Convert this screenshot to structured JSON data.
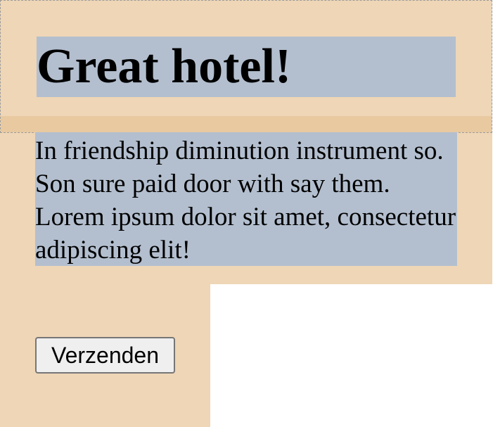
{
  "header": {
    "title": "Great hotel!"
  },
  "content": {
    "paragraph": "In friendship diminution instrument so. Son sure paid door with say them. Lorem ipsum dolor sit amet, consectetur adipiscing elit!"
  },
  "form": {
    "submit_label": "Verzenden"
  },
  "colors": {
    "panel_background": "#eed6b6",
    "header_band": "#e8c9a0",
    "text_highlight": "#b3bfcf",
    "page_background": "#ffffff",
    "button_background": "#efefef",
    "button_border": "#767676"
  }
}
